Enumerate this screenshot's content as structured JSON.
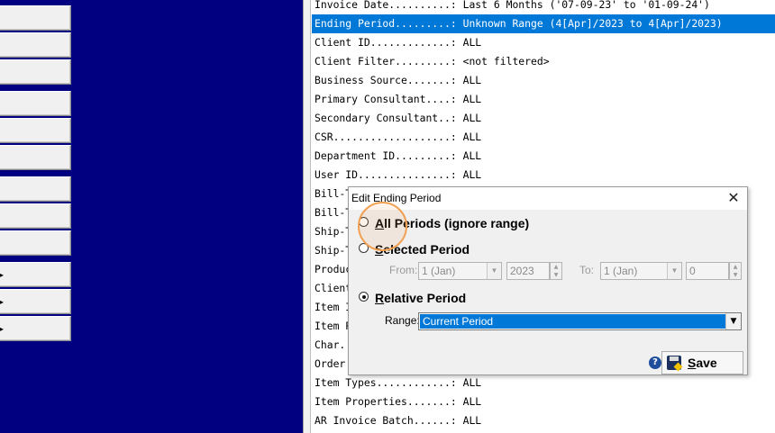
{
  "colors": {
    "left_panel": "#000080",
    "selection": "#0078d7",
    "highlight_ring": "#f0a050"
  },
  "criteria_rows": [
    {
      "text": "Invoice Date..........: Last 6 Months ('07-09-23' to '01-09-24')",
      "selected": false
    },
    {
      "text": "Ending Period.........: Unknown Range (4[Apr]/2023 to 4[Apr]/2023)",
      "selected": true
    },
    {
      "text": "Client ID.............: ALL",
      "selected": false
    },
    {
      "text": "Client Filter.........: <not filtered>",
      "selected": false
    },
    {
      "text": "Business Source.......: ALL",
      "selected": false
    },
    {
      "text": "Primary Consultant....: ALL",
      "selected": false
    },
    {
      "text": "Secondary Consultant..: ALL",
      "selected": false
    },
    {
      "text": "CSR...................: ALL",
      "selected": false
    },
    {
      "text": "Department ID.........: ALL",
      "selected": false
    },
    {
      "text": "User ID...............: ALL",
      "selected": false
    },
    {
      "text": "Bill-T",
      "selected": false
    },
    {
      "text": "Bill-T",
      "selected": false
    },
    {
      "text": "Ship-T",
      "selected": false
    },
    {
      "text": "Ship-T",
      "selected": false
    },
    {
      "text": "Produc",
      "selected": false
    },
    {
      "text": "Client",
      "selected": false
    },
    {
      "text": "Item I",
      "selected": false
    },
    {
      "text": "Item P",
      "selected": false
    },
    {
      "text": "Char.",
      "selected": false
    },
    {
      "text": "Order",
      "selected": false
    },
    {
      "text": "Item Types............: ALL",
      "selected": false
    },
    {
      "text": "Item Properties.......: ALL",
      "selected": false
    },
    {
      "text": "AR Invoice Batch......: ALL",
      "selected": false
    }
  ],
  "dialog": {
    "title": "Edit Ending Period",
    "close_glyph": "✕",
    "options": {
      "all_periods": {
        "first": "A",
        "rest": "ll Periods (ignore range)",
        "checked": false
      },
      "selected_period": {
        "first": "S",
        "rest": "elected Period",
        "checked": false
      },
      "relative_period": {
        "first": "R",
        "rest": "elative Period",
        "checked": true
      }
    },
    "from_label": "From:",
    "from_month": "1 (Jan)",
    "from_year": "2023",
    "to_label": "To:",
    "to_month": "1 (Jan)",
    "to_year": "0",
    "range_label": "Range:",
    "range_value": "Current Period",
    "help_glyph": "?",
    "save_first": "S",
    "save_rest": "ave"
  }
}
